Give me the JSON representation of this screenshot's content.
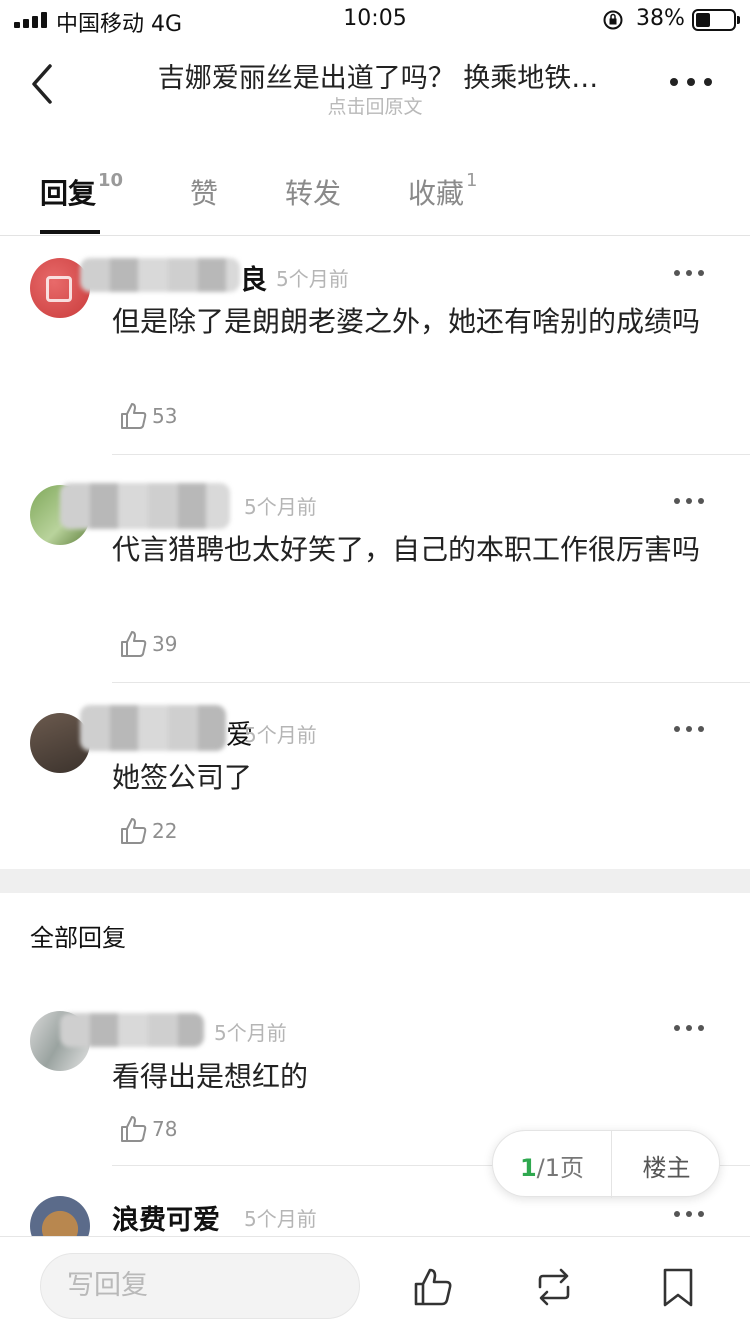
{
  "status_bar": {
    "carrier": "中国移动 4G",
    "time": "10:05",
    "battery": "38%"
  },
  "header": {
    "title": "吉娜爱丽丝是出道了吗？ 换乘地铁…",
    "subtitle": "点击回原文"
  },
  "tabs": [
    {
      "label": "回复",
      "count": "10"
    },
    {
      "label": "赞",
      "count": ""
    },
    {
      "label": "转发",
      "count": ""
    },
    {
      "label": "收藏",
      "count": "1"
    }
  ],
  "hot_comments": [
    {
      "username_tail": "良",
      "time": "5个月前",
      "text": "但是除了是朗朗老婆之外，她还有啥别的成绩吗",
      "likes": "53"
    },
    {
      "username_tail": "",
      "time": "5个月前",
      "text": "代言猎聘也太好笑了，自己的本职工作很厉害吗",
      "likes": "39"
    },
    {
      "username_tail": "爱",
      "time": "5个月前",
      "text": "她签公司了",
      "likes": "22"
    }
  ],
  "section_title": "全部回复",
  "all_comments": [
    {
      "username": "",
      "time": "5个月前",
      "text": "看得出是想红的",
      "likes": "78"
    },
    {
      "username": "浪费可爱",
      "time": "5个月前",
      "text": "",
      "likes": ""
    }
  ],
  "pager": {
    "current": "1",
    "total_suffix": "/1页",
    "op_only_label": "楼主"
  },
  "bottom_bar": {
    "reply_placeholder": "写回复"
  }
}
